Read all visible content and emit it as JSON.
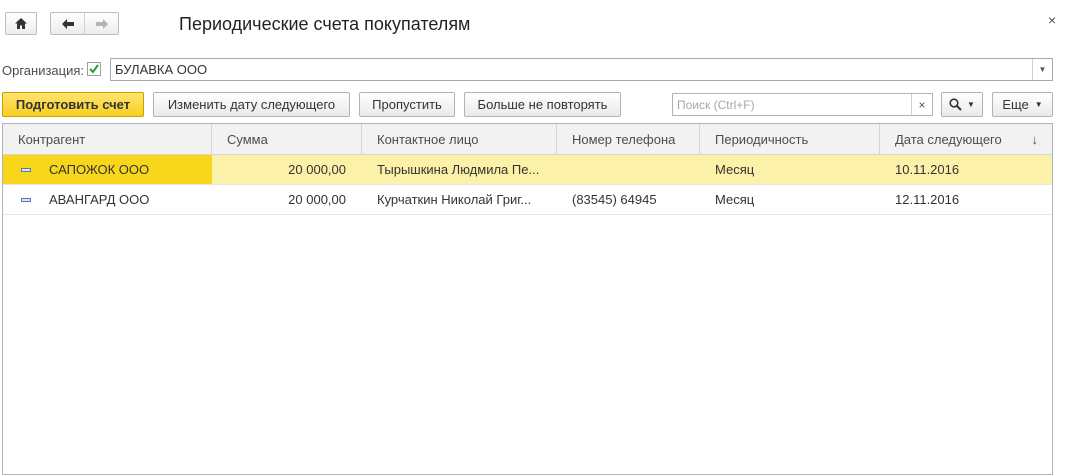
{
  "window": {
    "title": "Периодические счета покупателям",
    "close_glyph": "×"
  },
  "nav": {
    "home_icon": "home-icon",
    "back_icon": "arrow-left-icon",
    "forward_icon": "arrow-right-icon"
  },
  "organization": {
    "label": "Организация:",
    "checked": true,
    "value": "БУЛАВКА ООО"
  },
  "toolbar": {
    "prepare_invoice": "Подготовить счет",
    "change_next_date": "Изменить дату следующего",
    "skip": "Пропустить",
    "stop_repeating": "Больше не повторять",
    "search_placeholder": "Поиск (Ctrl+F)",
    "clear_glyph": "×",
    "more": "Еще"
  },
  "table": {
    "columns": [
      "Контрагент",
      "Сумма",
      "Контактное лицо",
      "Номер телефона",
      "Периодичность",
      "Дата следующего"
    ],
    "sort_glyph": "↓",
    "rows": [
      {
        "counterparty": "САПОЖОК ООО",
        "amount": "20 000,00",
        "contact": "Тырышкина Людмила Пе...",
        "phone": "",
        "periodicity": "Месяц",
        "next_date": "10.11.2016"
      },
      {
        "counterparty": "АВАНГАРД ООО",
        "amount": "20 000,00",
        "contact": "Курчаткин Николай Григ...",
        "phone": "(83545) 64945",
        "periodicity": "Месяц",
        "next_date": "12.11.2016"
      }
    ]
  },
  "colors": {
    "primary_button": "#f7cf1e",
    "selected_row": "#fcf1a9",
    "selected_cell": "#f8d71a"
  }
}
